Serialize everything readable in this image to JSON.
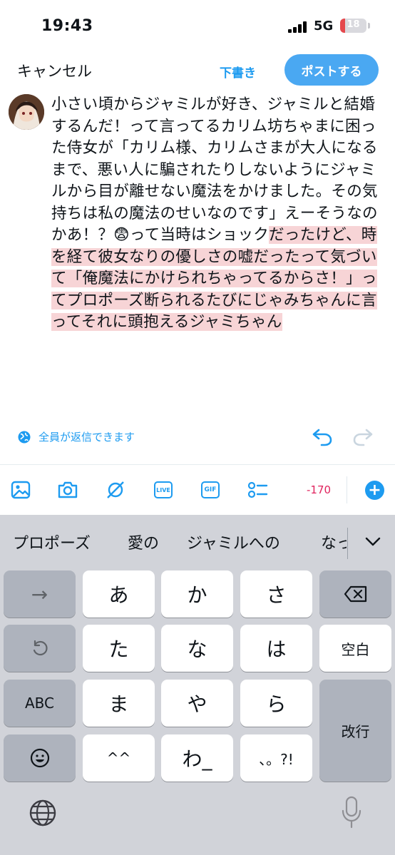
{
  "status": {
    "time": "19:43",
    "network": "5G",
    "battery": "18",
    "battery_level": 0.18
  },
  "compose": {
    "cancel_label": "キャンセル",
    "draft_label": "下書き",
    "post_label": "ポストする",
    "text_plain": "小さい頃からジャミルが好き、ジャミルと結婚するんだ！って言ってるカリム坊ちゃまに困った侍女が「カリム様、カリムさまが大人になるまで、悪い人に騙されたりしないようにジャミルから目が離せない魔法をかけました。その気持ちは私の魔法のせいなのです」えーそうなのかあ！？😨って当時はショック",
    "text_highlighted": "だったけど、時を経て彼女なりの優しさの嘘だったって気づいて「俺魔法にかけられちゃってるからさ！」ってプロポーズ断られるたびにじゃみちゃんに言ってそれに頭抱えるジャミちゃん",
    "reply_setting": "全員が返信できます",
    "char_count": "-170"
  },
  "icons": {
    "reply_setting": "globe-person-icon",
    "undo": "undo-icon",
    "redo": "redo-icon",
    "toolbar": [
      "image-icon",
      "camera-icon",
      "spaces-icon",
      "live-icon",
      "gif-icon",
      "poll-icon"
    ],
    "add": "plus-icon"
  },
  "toolbar_labels": {
    "live": "LIVE",
    "gif": "GIF"
  },
  "keyboard": {
    "suggestions": [
      "プロポーズ",
      "愛の",
      "ジャミルへの",
      "なっ"
    ],
    "keys": {
      "row1": [
        "→",
        "あ",
        "か",
        "さ",
        "⌫"
      ],
      "row2": [
        "↺",
        "た",
        "な",
        "は",
        "空白"
      ],
      "row3": [
        "ABC",
        "ま",
        "や",
        "ら",
        "改行"
      ],
      "row4": [
        "☺",
        "^^",
        "わ_",
        "、。?!"
      ]
    }
  },
  "colors": {
    "accent": "#1d9bf0",
    "highlight": "#f7d4d6",
    "counter": "#e0245e"
  }
}
